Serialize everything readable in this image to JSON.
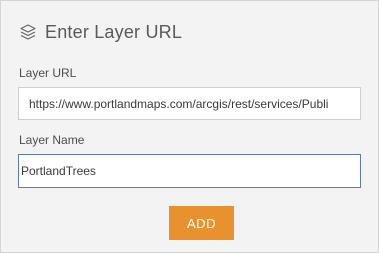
{
  "header": {
    "icon": "layers-icon",
    "title": "Enter Layer URL"
  },
  "form": {
    "url_label": "Layer URL",
    "url_value": "https://www.portlandmaps.com/arcgis/rest/services/Publi",
    "name_label": "Layer Name",
    "name_value": "PortlandTrees",
    "add_label": "ADD"
  },
  "colors": {
    "panel_bg": "#f3f3f3",
    "accent_button": "#e8912e",
    "focus_border": "#5a7db5"
  }
}
